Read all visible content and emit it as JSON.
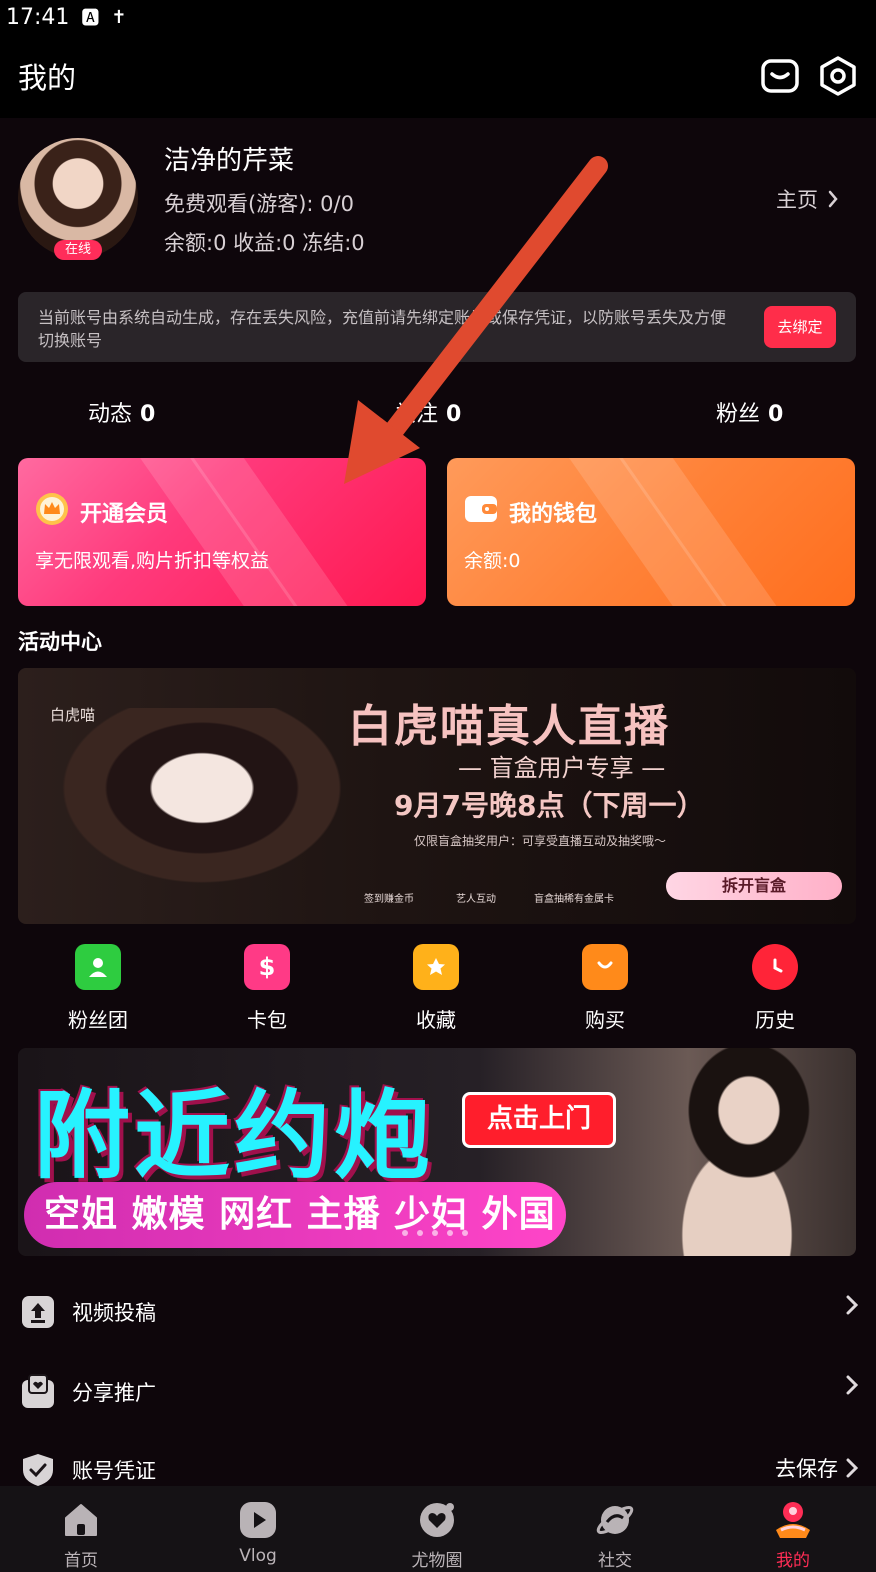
{
  "status_bar": {
    "time": "17:41",
    "icons": [
      "A",
      "accessibility-icon"
    ]
  },
  "header": {
    "title": "我的",
    "icons": [
      "message-icon",
      "settings-icon"
    ]
  },
  "profile": {
    "name": "洁净的芹菜",
    "online_badge": "在线",
    "free_watch": "免费观看(游客): 0/0",
    "balances": "余额:0 收益:0 冻结:0",
    "home_link": "主页"
  },
  "notice": {
    "text": "当前账号由系统自动生成，存在丢失风险，充值前请先绑定账号或保存凭证，以防账号丢失及方便切换账号",
    "button": "去绑定"
  },
  "stats": [
    {
      "label": "动态",
      "value": "0"
    },
    {
      "label": "关注",
      "value": "0"
    },
    {
      "label": "粉丝",
      "value": "0"
    }
  ],
  "cards": {
    "vip": {
      "title": "开通会员",
      "subtitle": "享无限观看,购片折扣等权益"
    },
    "wallet": {
      "title": "我的钱包",
      "subtitle": "余额:0"
    }
  },
  "activity": {
    "title": "活动中心",
    "banner1": {
      "title": "白虎喵真人直播",
      "subtitle": "— 盲盒用户专享 —",
      "date": "9月7号晚8点（下周一）",
      "note": "仅限盲盒抽奖用户：可享受直播互动及抽奖哦～",
      "features": [
        "签到赚金币",
        "艺人互动",
        "盲盒抽稀有金属卡"
      ],
      "button": "拆开盲盒",
      "left_text": "白虎喵"
    }
  },
  "quick_actions": [
    {
      "label": "粉丝团",
      "icon": "fan-group-icon",
      "color": "#2ecc40"
    },
    {
      "label": "卡包",
      "icon": "card-pack-icon",
      "color": "#ff3a86"
    },
    {
      "label": "收藏",
      "icon": "favorite-icon",
      "color": "#ffb11a"
    },
    {
      "label": "购买",
      "icon": "shopping-bag-icon",
      "color": "#ff8a1a"
    },
    {
      "label": "历史",
      "icon": "history-clock-icon",
      "color": "#ff2438"
    }
  ],
  "banner2": {
    "title": "附近约炮",
    "button": "点击上门",
    "bar_text": "空姐 嫩模 网红 主播 少妇 外国"
  },
  "menu": [
    {
      "label": "视频投稿",
      "icon": "upload-icon",
      "right": ""
    },
    {
      "label": "分享推广",
      "icon": "share-icon",
      "right": ""
    },
    {
      "label": "账号凭证",
      "icon": "shield-check-icon",
      "right": "去保存"
    }
  ],
  "tabs": [
    {
      "label": "首页",
      "icon": "home-icon",
      "active": false
    },
    {
      "label": "Vlog",
      "icon": "vlog-play-icon",
      "active": false
    },
    {
      "label": "尤物圈",
      "icon": "heart-circle-icon",
      "active": false
    },
    {
      "label": "社交",
      "icon": "planet-icon",
      "active": false
    },
    {
      "label": "我的",
      "icon": "profile-icon",
      "active": true
    }
  ],
  "colors": {
    "accent": "#ff2d55",
    "background": "#0e060b",
    "annotation_arrow": "#e04a2f"
  }
}
